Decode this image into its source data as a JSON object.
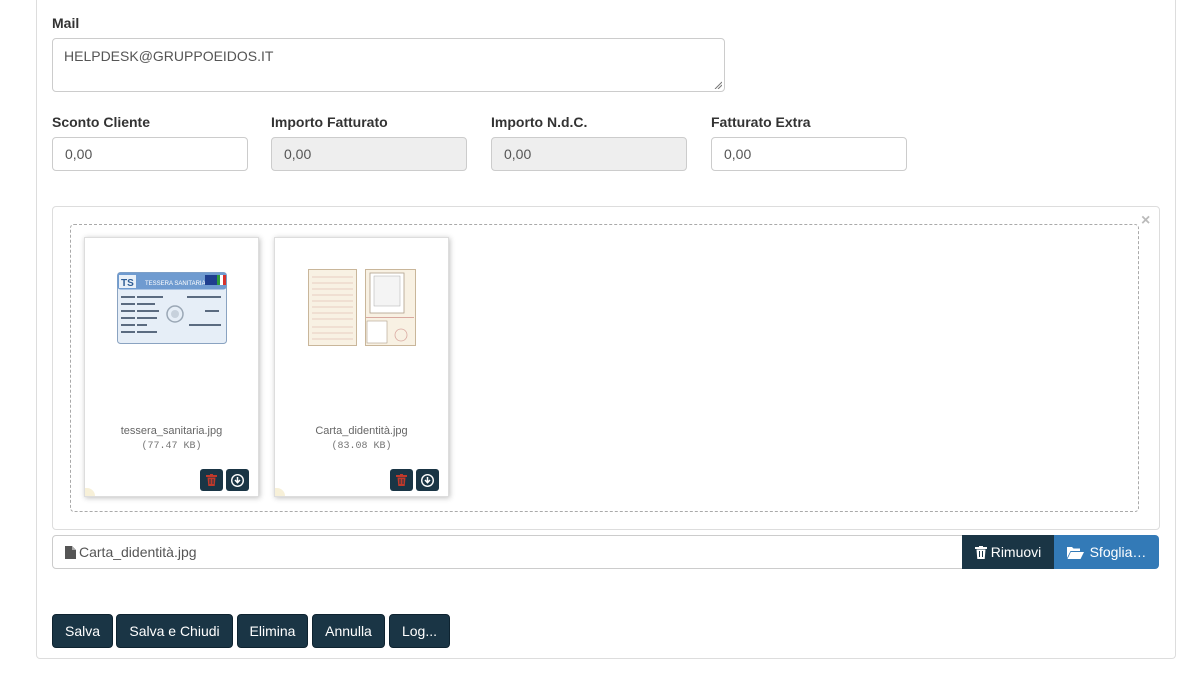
{
  "mail": {
    "label": "Mail",
    "value": "HELPDESK@GRUPPOEIDOS.IT"
  },
  "amounts": [
    {
      "label": "Sconto Cliente",
      "value": "0,00",
      "disabled": false
    },
    {
      "label": "Importo Fatturato",
      "value": "0,00",
      "disabled": true
    },
    {
      "label": "Importo N.d.C.",
      "value": "0,00",
      "disabled": true
    },
    {
      "label": "Fatturato Extra",
      "value": "0,00",
      "disabled": false
    }
  ],
  "uploads": {
    "close_symbol": "×",
    "files": [
      {
        "name": "tessera_sanitaria.jpg",
        "size": "(77.47 KB)",
        "card_title": "TESSERA SANITARIA"
      },
      {
        "name": "Carta_didentità.jpg",
        "size": "(83.08 KB)"
      }
    ],
    "caption": "Carta_didentità.jpg",
    "remove_label": "Rimuovi",
    "browse_label": "Sfoglia…"
  },
  "actions": {
    "save": "Salva",
    "save_close": "Salva e Chiudi",
    "delete": "Elimina",
    "cancel": "Annulla",
    "log": "Log..."
  },
  "colors": {
    "dark_button": "#1a3545",
    "primary_button": "#337ab7",
    "trash_red": "#c0392b"
  }
}
